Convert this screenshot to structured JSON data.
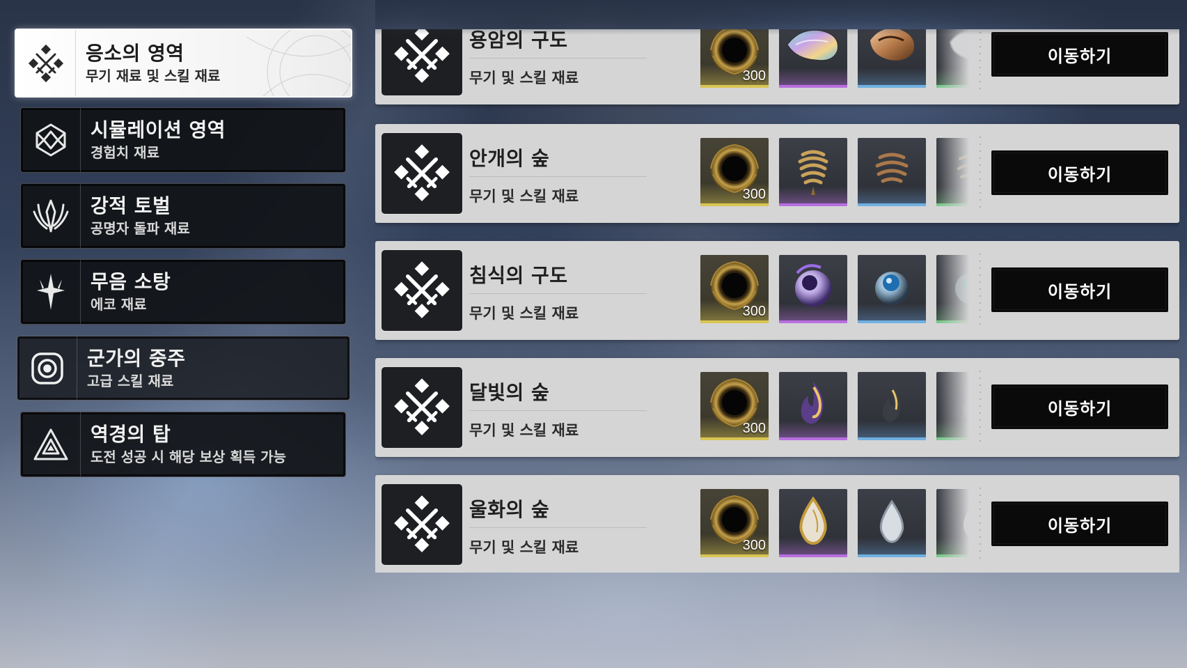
{
  "sidebar": {
    "items": [
      {
        "title": "응소의 영역",
        "subtitle": "무기 재료 및 스킬 재료",
        "icon": "swords-diamond-icon",
        "active": true
      },
      {
        "title": "시뮬레이션 영역",
        "subtitle": "경험치 재료",
        "icon": "simulation-emblem-icon",
        "active": false
      },
      {
        "title": "강적 토벌",
        "subtitle": "공명자 돌파 재료",
        "icon": "flame-crest-icon",
        "active": false
      },
      {
        "title": "무음 소탕",
        "subtitle": "에코 재료",
        "icon": "star-burst-icon",
        "active": false
      },
      {
        "title": "군가의 중주",
        "subtitle": "고급 스킬 재료",
        "icon": "target-ring-icon",
        "active": false
      },
      {
        "title": "역경의 탑",
        "subtitle": "도전 성공 시 해당 보상 획득 가능",
        "icon": "triangle-tower-icon",
        "active": false
      }
    ]
  },
  "domains": [
    {
      "name": "용암의 구도",
      "subtitle": "무기 및 스킬 재료",
      "button": "이동하기",
      "reward_qty": "300",
      "rewards": [
        "shell-credit-icon",
        "iridescent-shell-icon",
        "copper-shell-icon",
        "silver-shell-icon"
      ]
    },
    {
      "name": "안개의 숲",
      "subtitle": "무기 및 스킬 재료",
      "button": "이동하기",
      "reward_qty": "300",
      "rewards": [
        "shell-credit-icon",
        "spiral-gold-icon",
        "spiral-bronze-icon",
        "spiral-grey-icon"
      ]
    },
    {
      "name": "침식의 구도",
      "subtitle": "무기 및 스킬 재료",
      "button": "이동하기",
      "reward_qty": "300",
      "rewards": [
        "shell-credit-icon",
        "violet-orb-icon",
        "blue-orb-icon",
        "teal-orb-icon"
      ]
    },
    {
      "name": "달빛의 숲",
      "subtitle": "무기 및 스킬 재료",
      "button": "이동하기",
      "reward_qty": "300",
      "rewards": [
        "shell-credit-icon",
        "violet-flame-icon",
        "dark-flame-icon",
        "grey-flame-icon"
      ]
    },
    {
      "name": "울화의 숲",
      "subtitle": "무기 및 스킬 재료",
      "button": "이동하기",
      "reward_qty": "300",
      "rewards": [
        "shell-credit-icon",
        "gold-drop-icon",
        "silver-drop-icon",
        "pale-drop-icon"
      ]
    }
  ],
  "rarity_colors": {
    "gold": "#d9c552",
    "purple": "#b86ee0",
    "blue": "#6fb0e0",
    "green": "#72c784"
  }
}
